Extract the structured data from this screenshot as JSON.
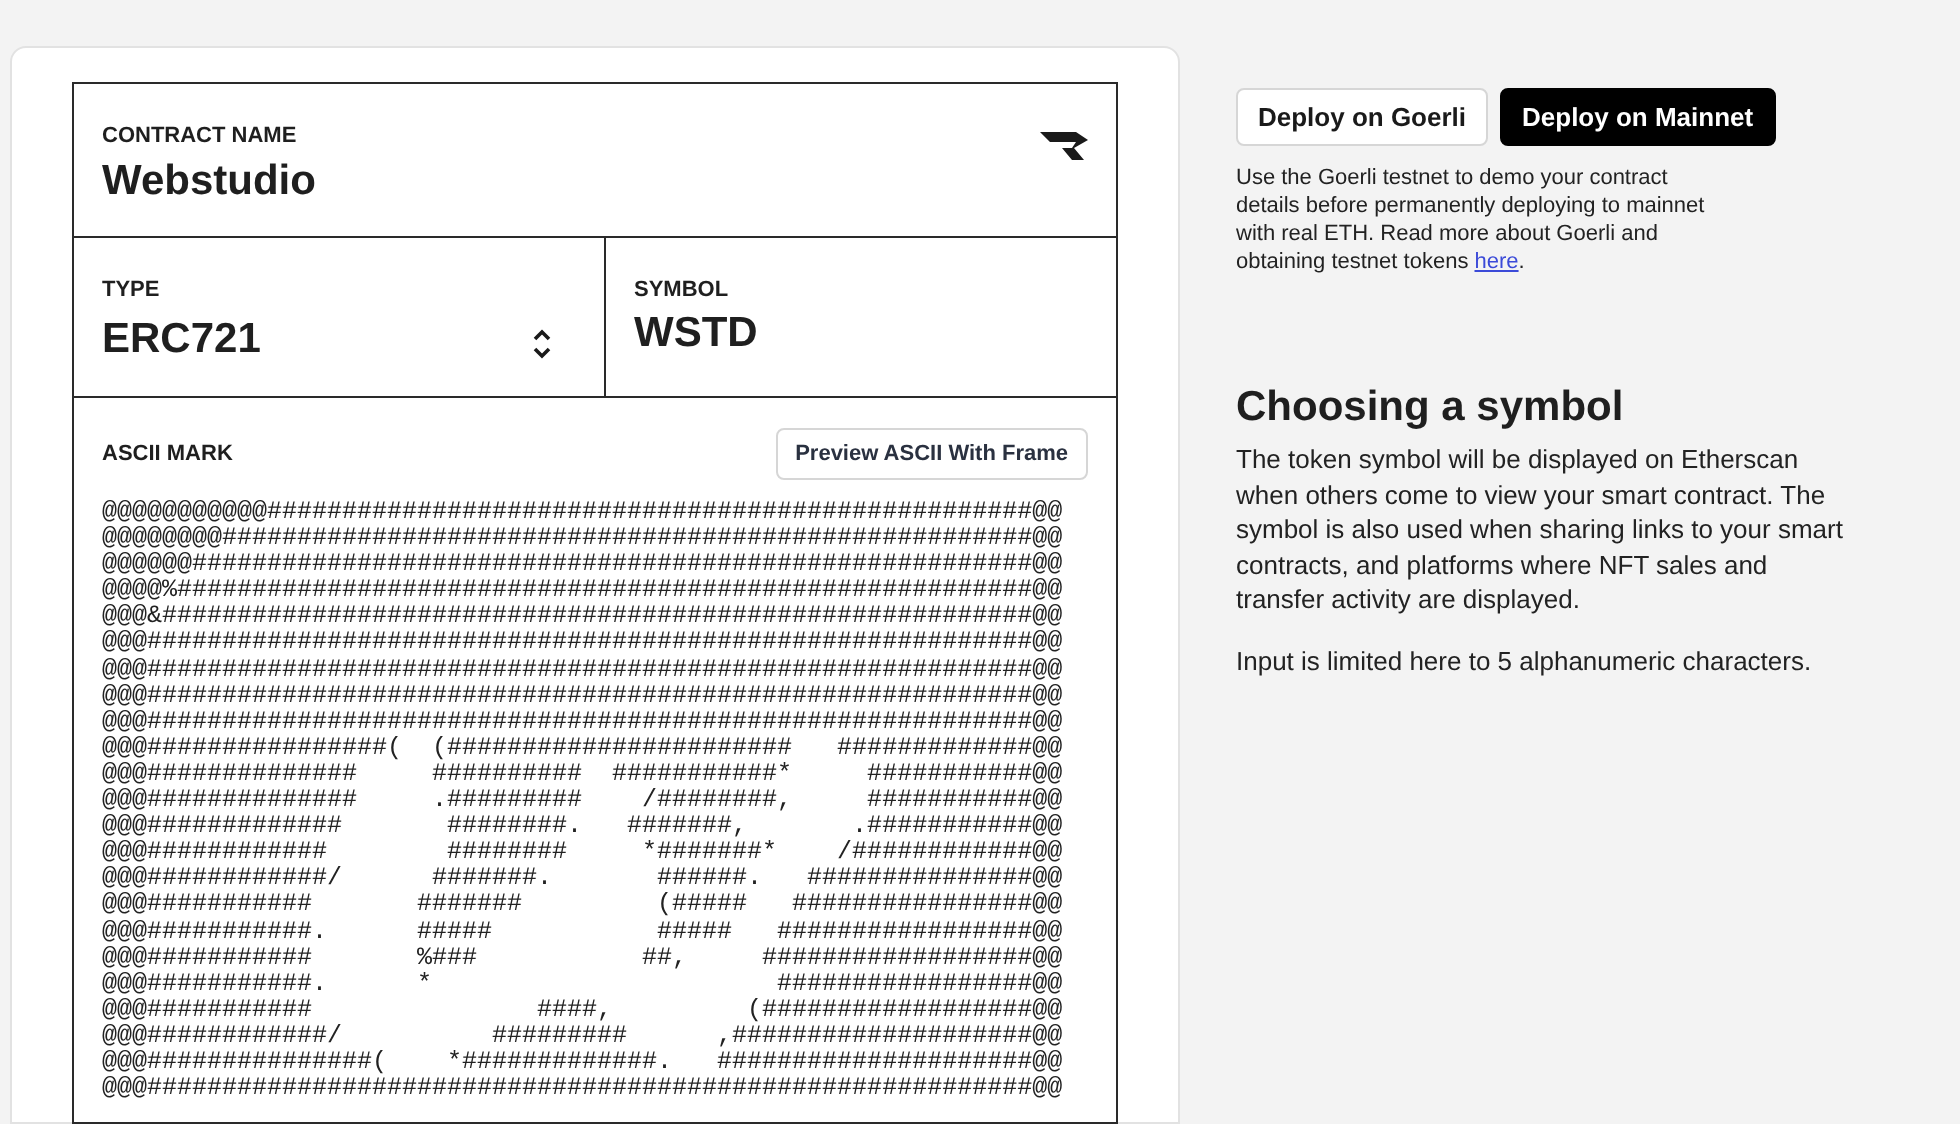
{
  "contract_form": {
    "contract_name": {
      "label": "CONTRACT NAME",
      "value": "Webstudio"
    },
    "type": {
      "label": "TYPE",
      "value": "ERC721"
    },
    "symbol": {
      "label": "SYMBOL",
      "value": "WSTD"
    },
    "ascii_mark": {
      "label": "ASCII MARK",
      "preview_button": "Preview ASCII With Frame",
      "lines": [
        "@@@@@@@@@@@###################################################@@",
        "@@@@@@@@######################################################@@",
        "@@@@@@########################################################@@",
        "@@@@%#########################################################@@",
        "@@@&##########################################################@@",
        "@@@###########################################################@@",
        "@@@###########################################################@@",
        "@@@###########################################################@@",
        "@@@###########################################################@@",
        "@@@################(  (#######################   #############@@",
        "@@@##############     ##########  ###########*     ###########@@",
        "@@@##############     .#########    /########,     ###########@@",
        "@@@#############       ########.   #######,       .###########@@",
        "@@@############        ########     *#######*    /############@@",
        "@@@############/      #######.       ######.   ###############@@",
        "@@@###########       #######         (#####   ################@@",
        "@@@###########.      #####           #####   #################@@",
        "@@@###########       %###           ##,     ##################@@",
        "@@@###########.      *                       #################@@",
        "@@@###########               ####,         (##################@@",
        "@@@############/          #########      ,####################@@",
        "@@@###############(    *#############.   #####################@@",
        "@@@###########################################################@@"
      ]
    }
  },
  "deploy": {
    "buttons": [
      {
        "label": "Deploy on Goerli",
        "kind": "outline"
      },
      {
        "label": "Deploy on Mainnet",
        "kind": "solid"
      }
    ],
    "note": {
      "text_before": "Use the Goerli testnet to demo your contract details before permanently deploying to mainnet with real ETH. Read more about Goerli and obtaining testnet tokens ",
      "link": "here",
      "text_after": "."
    }
  },
  "help": {
    "title": "Choosing a symbol",
    "paragraphs": [
      "The token symbol will be displayed on Etherscan when others come to view your smart contract. The symbol is also used when sharing links to your smart contracts, and platforms where NFT sales and transfer activity are displayed.",
      "Input is limited here to 5 alphanumeric characters."
    ]
  }
}
